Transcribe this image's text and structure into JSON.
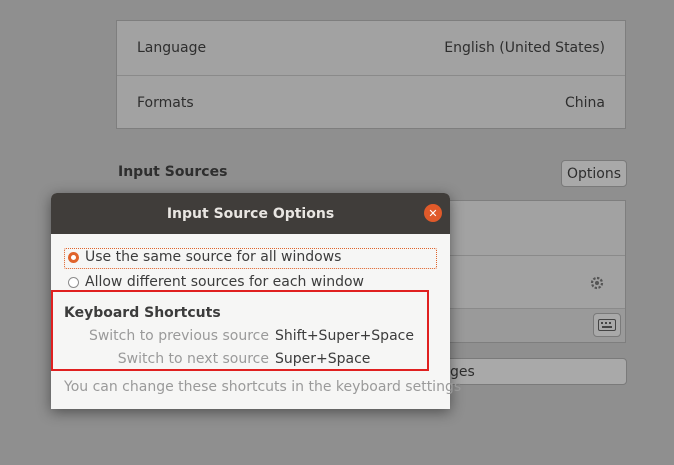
{
  "region_panel": {
    "language_label": "Language",
    "language_value": "English (United States)",
    "formats_label": "Formats",
    "formats_value": "China",
    "input_sources_title": "Input Sources",
    "options_button": "Options",
    "partial_button_text": "ges"
  },
  "dialog": {
    "title": "Input Source Options",
    "radio_same": "Use the same source for all windows",
    "radio_different": "Allow different sources for each window",
    "selected_radio": "radio_same",
    "shortcuts_title": "Keyboard Shortcuts",
    "shortcuts": [
      {
        "label": "Switch to previous source",
        "value": "Shift+Super+Space"
      },
      {
        "label": "Switch to next source",
        "value": "Super+Space"
      }
    ],
    "hint": "You can change these shortcuts in the keyboard settings"
  },
  "icons": {
    "close": "close-icon",
    "gear": "gear-icon",
    "keyboard": "keyboard-icon"
  },
  "colors": {
    "accent": "#e0632b",
    "highlight_box": "#e02020",
    "titlebar": "#403d3a"
  }
}
